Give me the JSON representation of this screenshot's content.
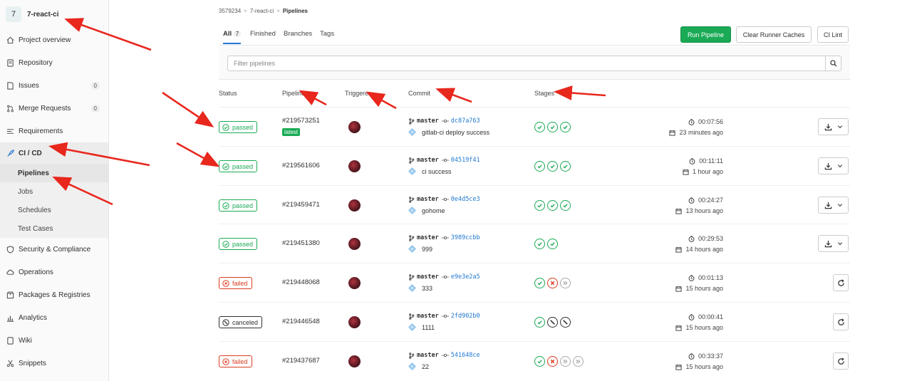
{
  "project": {
    "avatar_letter": "7",
    "name": "7-react-ci"
  },
  "sidebar": {
    "items": [
      {
        "label": "Project overview",
        "icon": "home-icon"
      },
      {
        "label": "Repository",
        "icon": "book-icon"
      },
      {
        "label": "Issues",
        "icon": "issues-icon",
        "badge": "0"
      },
      {
        "label": "Merge Requests",
        "icon": "git-merge-icon",
        "badge": "0"
      },
      {
        "label": "Requirements",
        "icon": "requirements-icon"
      },
      {
        "label": "CI / CD",
        "icon": "rocket-icon"
      }
    ],
    "cicd_sub": [
      "Pipelines",
      "Jobs",
      "Schedules",
      "Test Cases"
    ],
    "bottom_items": [
      {
        "label": "Security & Compliance",
        "icon": "shield-icon"
      },
      {
        "label": "Operations",
        "icon": "cloud-gear-icon"
      },
      {
        "label": "Packages & Registries",
        "icon": "package-icon"
      },
      {
        "label": "Analytics",
        "icon": "chart-icon"
      },
      {
        "label": "Wiki",
        "icon": "book-icon"
      },
      {
        "label": "Snippets",
        "icon": "scissors-icon"
      }
    ]
  },
  "breadcrumb": {
    "group": "3579234",
    "project": "7-react-ci",
    "current": "Pipelines",
    "sep": ">"
  },
  "tabs": {
    "all": "All",
    "all_count": "7",
    "finished": "Finished",
    "branches": "Branches",
    "tags": "Tags"
  },
  "buttons": {
    "run": "Run Pipeline",
    "clear": "Clear Runner Caches",
    "lint": "CI Lint"
  },
  "filter": {
    "placeholder": "Filter pipelines"
  },
  "columns": {
    "status": "Status",
    "pipeline": "Pipeline",
    "triggerer": "Triggerer",
    "commit": "Commit",
    "stages": "Stages"
  },
  "latest_label": "latest",
  "pipelines": [
    {
      "status": "passed",
      "id": "#219573251",
      "branch": "master",
      "sha": "dc87a763",
      "message": "gitlab-ci deploy success",
      "stages": [
        "success",
        "success",
        "success"
      ],
      "duration": "00:07:56",
      "ago": "23 minutes ago",
      "action": "download",
      "latest": true
    },
    {
      "status": "passed",
      "id": "#219561606",
      "branch": "master",
      "sha": "04519f41",
      "message": "ci success",
      "stages": [
        "success",
        "success",
        "success"
      ],
      "duration": "00:11:11",
      "ago": "1 hour ago",
      "action": "download"
    },
    {
      "status": "passed",
      "id": "#219459471",
      "branch": "master",
      "sha": "0e4d5ce3",
      "message": "gohome",
      "stages": [
        "success",
        "success",
        "success"
      ],
      "duration": "00:24:27",
      "ago": "13 hours ago",
      "action": "download"
    },
    {
      "status": "passed",
      "id": "#219451380",
      "branch": "master",
      "sha": "3989ccbb",
      "message": "999",
      "stages": [
        "success",
        "success"
      ],
      "duration": "00:29:53",
      "ago": "14 hours ago",
      "action": "download"
    },
    {
      "status": "failed",
      "id": "#219448068",
      "branch": "master",
      "sha": "e9e3e2a5",
      "message": "333",
      "stages": [
        "success",
        "failed",
        "skipped"
      ],
      "duration": "00:01:13",
      "ago": "15 hours ago",
      "action": "retry"
    },
    {
      "status": "canceled",
      "id": "#219446548",
      "branch": "master",
      "sha": "2fd902b0",
      "message": "1111",
      "stages": [
        "success",
        "canceled",
        "canceled"
      ],
      "duration": "00:00:41",
      "ago": "15 hours ago",
      "action": "retry"
    },
    {
      "status": "failed",
      "id": "#219437687",
      "branch": "master",
      "sha": "541648ce",
      "message": "22",
      "stages": [
        "success",
        "failed",
        "skipped",
        "skipped"
      ],
      "duration": "00:33:37",
      "ago": "15 hours ago",
      "action": "retry"
    }
  ],
  "colors": {
    "success": "#1aaa55",
    "failed": "#db3b21",
    "link": "#1f78d1",
    "arrow": "#e8271d"
  }
}
